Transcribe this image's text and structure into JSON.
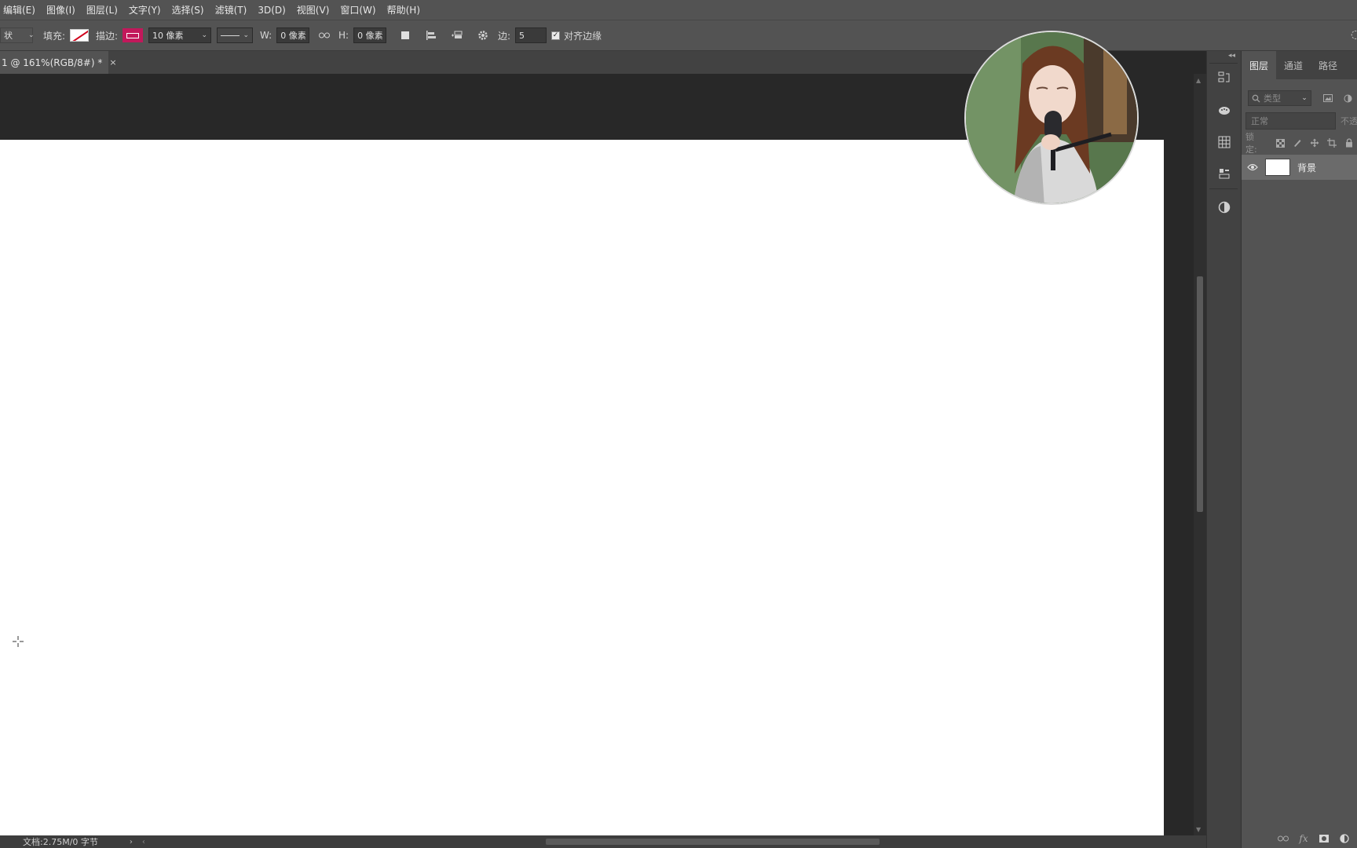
{
  "menu": [
    "编辑(E)",
    "图像(I)",
    "图层(L)",
    "文字(Y)",
    "选择(S)",
    "滤镜(T)",
    "3D(D)",
    "视图(V)",
    "窗口(W)",
    "帮助(H)"
  ],
  "options": {
    "shape_mode_partial": "状",
    "fill_label": "填充:",
    "stroke_label": "描边:",
    "stroke_width": "10 像素",
    "w_label": "W:",
    "w_value": "0 像素",
    "h_label": "H:",
    "h_value": "0 像素",
    "sides_label": "边:",
    "sides_value": "5",
    "align_edges_label": "对齐边缘",
    "align_edges_checked": true,
    "fill_color": "none",
    "stroke_color": "#c2185b"
  },
  "document": {
    "tab_label": "1 @ 161%(RGB/8#) *",
    "tab_close": "×",
    "background_color": "#ffffff"
  },
  "status": {
    "doc_info": "文档:2.75M/0 字节",
    "arrow": "›",
    "left_arrow": "‹"
  },
  "layers_panel": {
    "tabs": [
      "图层",
      "通道",
      "路径"
    ],
    "active_tab": "图层",
    "filter_placeholder": "类型",
    "blend_mode": "正常",
    "opacity_label": "不透",
    "lock_label": "锁定:",
    "layers": [
      {
        "name": "背景",
        "visible": true
      }
    ],
    "bottom_icons": [
      "link-icon",
      "fx-icon",
      "mask-icon",
      "adjustment-icon"
    ],
    "fx_text": "fx"
  },
  "dock_icons": [
    "history-icon",
    "brush-settings-icon",
    "grid-icon",
    "properties-icon",
    "adjustments-icon"
  ],
  "overlay": {
    "type": "webcam",
    "description_hidden": true
  },
  "colors": {
    "ui_bg": "#535353",
    "canvas_bg": "#282828",
    "accent": "#c2185b"
  }
}
